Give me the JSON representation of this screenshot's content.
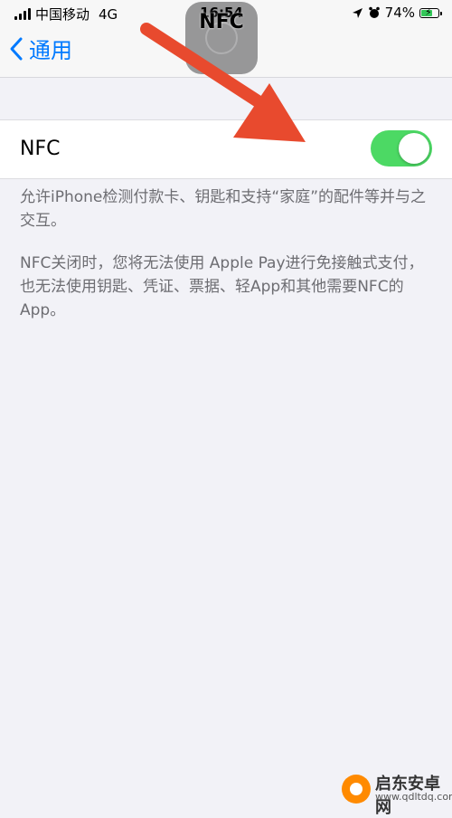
{
  "status_bar": {
    "carrier": "中国移动",
    "network": "4G",
    "time": "16:54",
    "battery_percent": "74%",
    "battery_level": 0.74
  },
  "nav": {
    "back_label": "通用",
    "title": "NFC"
  },
  "settings": {
    "nfc_label": "NFC",
    "nfc_enabled": true,
    "toggle_color": "#4cd964"
  },
  "footer": {
    "text1": "允许iPhone检测付款卡、钥匙和支持“家庭”的配件等并与之交互。",
    "text2": "NFC关闭时，您将无法使用 Apple Pay进行免接触式支付，也无法使用钥匙、凭证、票据、轻App和其他需要NFC的App。"
  },
  "watermark": {
    "name": "启东安卓网",
    "url": "www.qdltdq.com"
  },
  "annotation": {
    "arrow_color": "#e84a2e"
  }
}
